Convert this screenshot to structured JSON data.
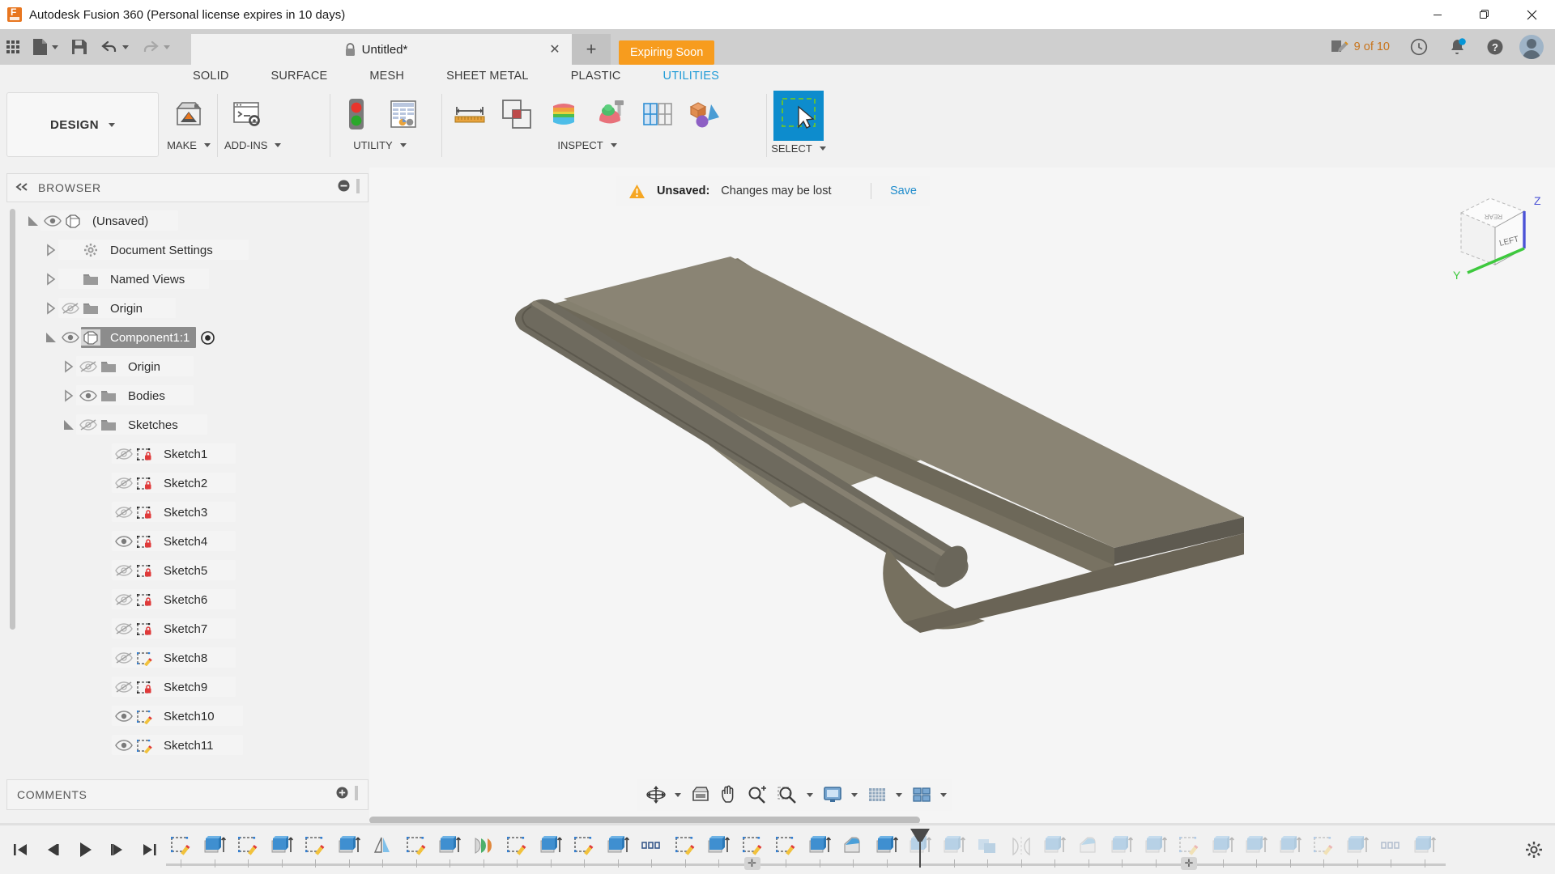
{
  "window": {
    "app_title": "Autodesk Fusion 360 (Personal license expires in 10 days)",
    "app_icon": "fusion-logo-icon",
    "minimize_label": "minimize-icon",
    "restore_label": "restore-icon",
    "close_label": "close-icon"
  },
  "quick_access": {
    "grid_label": "app-grid-icon",
    "new_label": "new-document-icon",
    "save_label": "save-icon",
    "undo_label": "undo-icon",
    "redo_label": "redo-icon",
    "document_tab": {
      "title": "Untitled*",
      "lock_icon": "lock-icon",
      "close_icon": "close-icon"
    },
    "new_tab_label": "+",
    "expiring_badge": "Expiring Soon",
    "jobs_count": "9 of 10",
    "jobs_icon": "jobs-pencil-icon",
    "history_icon": "clock-history-icon",
    "notification_icon": "bell-icon",
    "help_icon": "help-question-icon",
    "avatar_icon": "user-avatar"
  },
  "ribbon": {
    "workspace": "DESIGN",
    "tabs": [
      {
        "label": "SOLID",
        "active": false
      },
      {
        "label": "SURFACE",
        "active": false
      },
      {
        "label": "MESH",
        "active": false
      },
      {
        "label": "SHEET METAL",
        "active": false
      },
      {
        "label": "PLASTIC",
        "active": false
      },
      {
        "label": "UTILITIES",
        "active": true
      }
    ],
    "groups": [
      {
        "label": "MAKE",
        "items": [
          "3d-print-icon"
        ]
      },
      {
        "label": "ADD-INS",
        "items": [
          "scripts-and-addins-icon"
        ]
      },
      {
        "label": "UTILITY",
        "items": [
          "traffic-light-icon",
          "spreadsheet-icon"
        ]
      },
      {
        "label": "INSPECT",
        "items": [
          "measure-ruler-icon",
          "interference-icon",
          "section-analysis-icon",
          "curvature-comb-icon",
          "zebra-stripe-icon",
          "component-color-cycle-icon"
        ]
      },
      {
        "label": "SELECT",
        "items": [
          "selection-filter-icon"
        ]
      }
    ],
    "accent_color": "#1f9bd7"
  },
  "browser": {
    "title": "BROWSER",
    "collapse_icon": "collapse-left-icon",
    "minus_icon": "minus-circle-icon",
    "grip_icon": "resize-grip-icon",
    "tree": [
      {
        "label": "(Unsaved)",
        "indent": 0,
        "arrow": "expanded",
        "eye": "visible",
        "icon": "component-icon",
        "selected": false
      },
      {
        "label": "Document Settings",
        "indent": 1,
        "arrow": "collapsed",
        "eye": "none",
        "icon": "gear-icon",
        "selected": false
      },
      {
        "label": "Named Views",
        "indent": 1,
        "arrow": "collapsed",
        "eye": "none",
        "icon": "folder-icon",
        "selected": false
      },
      {
        "label": "Origin",
        "indent": 1,
        "arrow": "collapsed",
        "eye": "hidden",
        "icon": "folder-icon",
        "selected": false
      },
      {
        "label": "Component1:1",
        "indent": 1,
        "arrow": "expanded",
        "eye": "visible",
        "icon": "component-icon",
        "selected": true,
        "activate_icon": "activate-target-icon"
      },
      {
        "label": "Origin",
        "indent": 2,
        "arrow": "collapsed",
        "eye": "hidden",
        "icon": "folder-icon",
        "selected": false
      },
      {
        "label": "Bodies",
        "indent": 2,
        "arrow": "collapsed",
        "eye": "visible",
        "icon": "folder-icon",
        "selected": false
      },
      {
        "label": "Sketches",
        "indent": 2,
        "arrow": "expanded",
        "eye": "hidden",
        "icon": "folder-icon",
        "selected": false
      },
      {
        "label": "Sketch1",
        "indent": 3,
        "arrow": "none",
        "eye": "hidden",
        "icon": "sketch-locked-icon",
        "selected": false
      },
      {
        "label": "Sketch2",
        "indent": 3,
        "arrow": "none",
        "eye": "hidden",
        "icon": "sketch-locked-icon",
        "selected": false
      },
      {
        "label": "Sketch3",
        "indent": 3,
        "arrow": "none",
        "eye": "hidden",
        "icon": "sketch-locked-icon",
        "selected": false
      },
      {
        "label": "Sketch4",
        "indent": 3,
        "arrow": "none",
        "eye": "visible",
        "icon": "sketch-locked-icon",
        "selected": false
      },
      {
        "label": "Sketch5",
        "indent": 3,
        "arrow": "none",
        "eye": "hidden",
        "icon": "sketch-locked-icon",
        "selected": false
      },
      {
        "label": "Sketch6",
        "indent": 3,
        "arrow": "none",
        "eye": "hidden",
        "icon": "sketch-locked-icon",
        "selected": false
      },
      {
        "label": "Sketch7",
        "indent": 3,
        "arrow": "none",
        "eye": "hidden",
        "icon": "sketch-locked-icon",
        "selected": false
      },
      {
        "label": "Sketch8",
        "indent": 3,
        "arrow": "none",
        "eye": "hidden",
        "icon": "sketch-editable-icon",
        "selected": false
      },
      {
        "label": "Sketch9",
        "indent": 3,
        "arrow": "none",
        "eye": "hidden",
        "icon": "sketch-locked-icon",
        "selected": false
      },
      {
        "label": "Sketch10",
        "indent": 3,
        "arrow": "none",
        "eye": "visible",
        "icon": "sketch-editable-icon",
        "selected": false
      },
      {
        "label": "Sketch11",
        "indent": 3,
        "arrow": "none",
        "eye": "visible",
        "icon": "sketch-editable-icon",
        "selected": false
      }
    ]
  },
  "comments": {
    "title": "COMMENTS",
    "add_icon": "add-comment-icon",
    "grip_icon": "resize-grip-icon"
  },
  "canvas": {
    "unsaved_banner": {
      "warning_icon": "warning-triangle-icon",
      "label": "Unsaved:",
      "message": "Changes may be lost",
      "save_link": "Save"
    },
    "model_description": "shaded grey hinge body with two knuckle barrels, isometric view",
    "model_color": "#7d7669",
    "background_color": "#f5f5f5",
    "viewcube": {
      "visible_face": "LEFT",
      "axis_z": "Z",
      "axis_y": "Y",
      "axis_z_color": "#4b52d6",
      "axis_y_color": "#3ec93e"
    },
    "navbar": [
      "orbit-icon",
      "look-at-icon",
      "pan-icon",
      "zoom-icon",
      "zoom-window-icon",
      "display-settings-icon",
      "grid-snap-icon",
      "viewport-layout-icon"
    ]
  },
  "timeline": {
    "playback": [
      "go-to-start-icon",
      "step-back-icon",
      "play-icon",
      "step-forward-icon",
      "go-to-end-icon"
    ],
    "settings_icon": "timeline-settings-icon",
    "add_icon": "add-marker-icon",
    "playhead_index": 22,
    "features": [
      {
        "type": "sketch"
      },
      {
        "type": "extrude"
      },
      {
        "type": "sketch"
      },
      {
        "type": "extrude"
      },
      {
        "type": "sketch"
      },
      {
        "type": "extrude"
      },
      {
        "type": "mirror"
      },
      {
        "type": "sketch"
      },
      {
        "type": "extrude"
      },
      {
        "type": "revolve"
      },
      {
        "type": "sketch"
      },
      {
        "type": "extrude"
      },
      {
        "type": "sketch"
      },
      {
        "type": "extrude"
      },
      {
        "type": "pattern"
      },
      {
        "type": "sketch"
      },
      {
        "type": "extrude"
      },
      {
        "type": "sketch"
      },
      {
        "type": "sketch"
      },
      {
        "type": "extrude"
      },
      {
        "type": "fillet"
      },
      {
        "type": "extrude"
      },
      {
        "type": "extrude",
        "disabled": true
      },
      {
        "type": "extrude",
        "disabled": true
      },
      {
        "type": "combine",
        "disabled": true
      },
      {
        "type": "mirror-feature",
        "disabled": true
      },
      {
        "type": "extrude",
        "disabled": true
      },
      {
        "type": "fillet",
        "disabled": true
      },
      {
        "type": "extrude",
        "disabled": true
      },
      {
        "type": "extrude",
        "disabled": true
      },
      {
        "type": "sketch",
        "disabled": true
      },
      {
        "type": "extrude",
        "disabled": true
      },
      {
        "type": "extrude",
        "disabled": true
      },
      {
        "type": "extrude",
        "disabled": true
      },
      {
        "type": "sketch",
        "disabled": true
      },
      {
        "type": "extrude",
        "disabled": true
      },
      {
        "type": "pattern",
        "disabled": true
      },
      {
        "type": "extrude",
        "disabled": true
      }
    ]
  }
}
